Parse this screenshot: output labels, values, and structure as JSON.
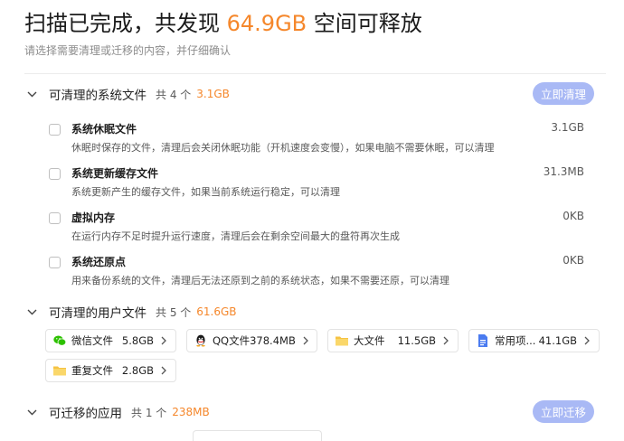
{
  "header": {
    "title_prefix": "扫描已完成，共发现 ",
    "title_size": "64.9GB",
    "title_suffix": " 空间可释放",
    "subtitle": "请选择需要清理或迁移的内容，并仔细确认"
  },
  "colors": {
    "accent": "#f5872b",
    "button": "#a9b9f5"
  },
  "system_section": {
    "title": "可清理的系统文件",
    "count": "共 4 个",
    "size": "3.1GB",
    "action": "立即清理",
    "items": [
      {
        "title": "系统休眠文件",
        "desc": "休眠时保存的文件，清理后会关闭休眠功能（开机速度会变慢），如果电脑不需要休眠，可以清理",
        "size": "3.1GB"
      },
      {
        "title": "系统更新缓存文件",
        "desc": "系统更新产生的缓存文件，如果当前系统运行稳定，可以清理",
        "size": "31.3MB"
      },
      {
        "title": "虚拟内存",
        "desc": "在运行内存不足时提升运行速度，清理后会在剩余空间最大的盘符再次生成",
        "size": "0KB"
      },
      {
        "title": "系统还原点",
        "desc": "用来备份系统的文件，清理后无法还原到之前的系统状态，如果不需要还原，可以清理",
        "size": "0KB"
      }
    ]
  },
  "user_section": {
    "title": "可清理的用户文件",
    "count": "共 5 个",
    "size": "61.6GB",
    "chips": [
      {
        "name": "微信文件",
        "size": "5.8GB",
        "icon": "wechat-icon"
      },
      {
        "name": "QQ文件",
        "size": "378.4MB",
        "icon": "qq-icon"
      },
      {
        "name": "大文件",
        "size": "11.5GB",
        "icon": "folder-icon"
      },
      {
        "name": "常用项...",
        "size": "41.1GB",
        "icon": "document-icon"
      },
      {
        "name": "重复文件",
        "size": "2.8GB",
        "icon": "folder-icon"
      }
    ]
  },
  "app_section": {
    "title": "可迁移的应用",
    "count": "共 1 个",
    "size": "238MB",
    "action": "立即迁移"
  }
}
